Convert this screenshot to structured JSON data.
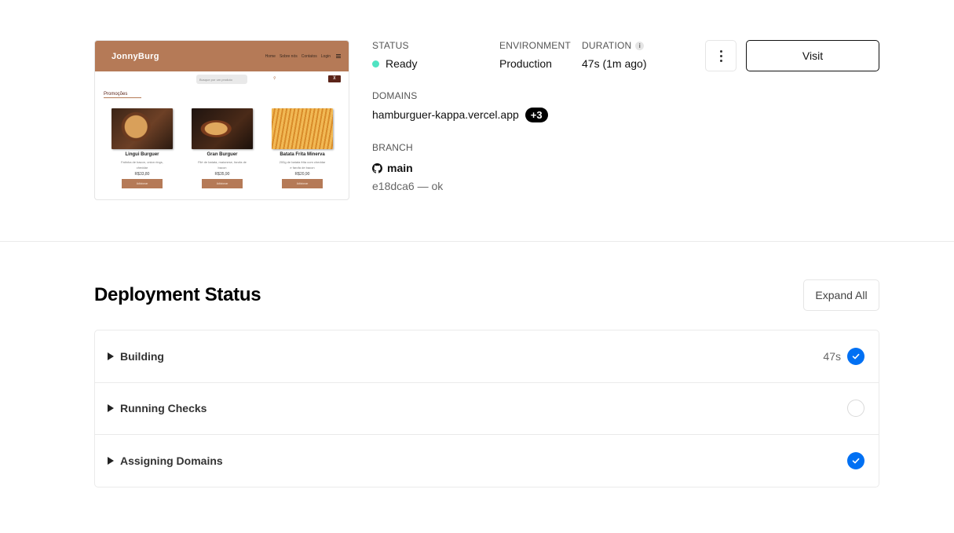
{
  "preview": {
    "logo": "JonnyBurg",
    "nav": [
      "Home",
      "Sobre nós",
      "Contatos",
      "Login"
    ],
    "search_placeholder": "Busque por um produto",
    "section": "Promoções",
    "products": [
      {
        "name": "Lingui Burguer",
        "desc": "Fatinha de bacon, onion rings, cheddar",
        "price": "R$33,80",
        "button": "Adicionar"
      },
      {
        "name": "Gran Burguer",
        "desc": "Filé de batata, maionese, farofa de bacon",
        "price": "R$35,90",
        "button": "Adicionar"
      },
      {
        "name": "Batata Frita Minerva",
        "desc": "200g de batata frita com cheddar e farofa de bacon",
        "price": "R$20,90",
        "button": "Adicionar"
      }
    ]
  },
  "summary": {
    "status_label": "STATUS",
    "status_value": "Ready",
    "status_color": "#50e3c2",
    "environment_label": "ENVIRONMENT",
    "environment_value": "Production",
    "duration_label": "DURATION",
    "duration_value": "47s",
    "duration_ago": "(1m ago)",
    "domains_label": "DOMAINS",
    "domain": "hamburguer-kappa.vercel.app",
    "domain_extra": "+3",
    "branch_label": "BRANCH",
    "branch": "main",
    "commit": "e18dca6 — ok"
  },
  "actions": {
    "more_icon": "more-vertical-icon",
    "visit_label": "Visit"
  },
  "deployment": {
    "title": "Deployment Status",
    "expand_label": "Expand All",
    "accent": "#0070f3",
    "steps": [
      {
        "label": "Building",
        "time": "47s",
        "state": "done"
      },
      {
        "label": "Running Checks",
        "time": "",
        "state": "pending"
      },
      {
        "label": "Assigning Domains",
        "time": "",
        "state": "done"
      }
    ]
  }
}
